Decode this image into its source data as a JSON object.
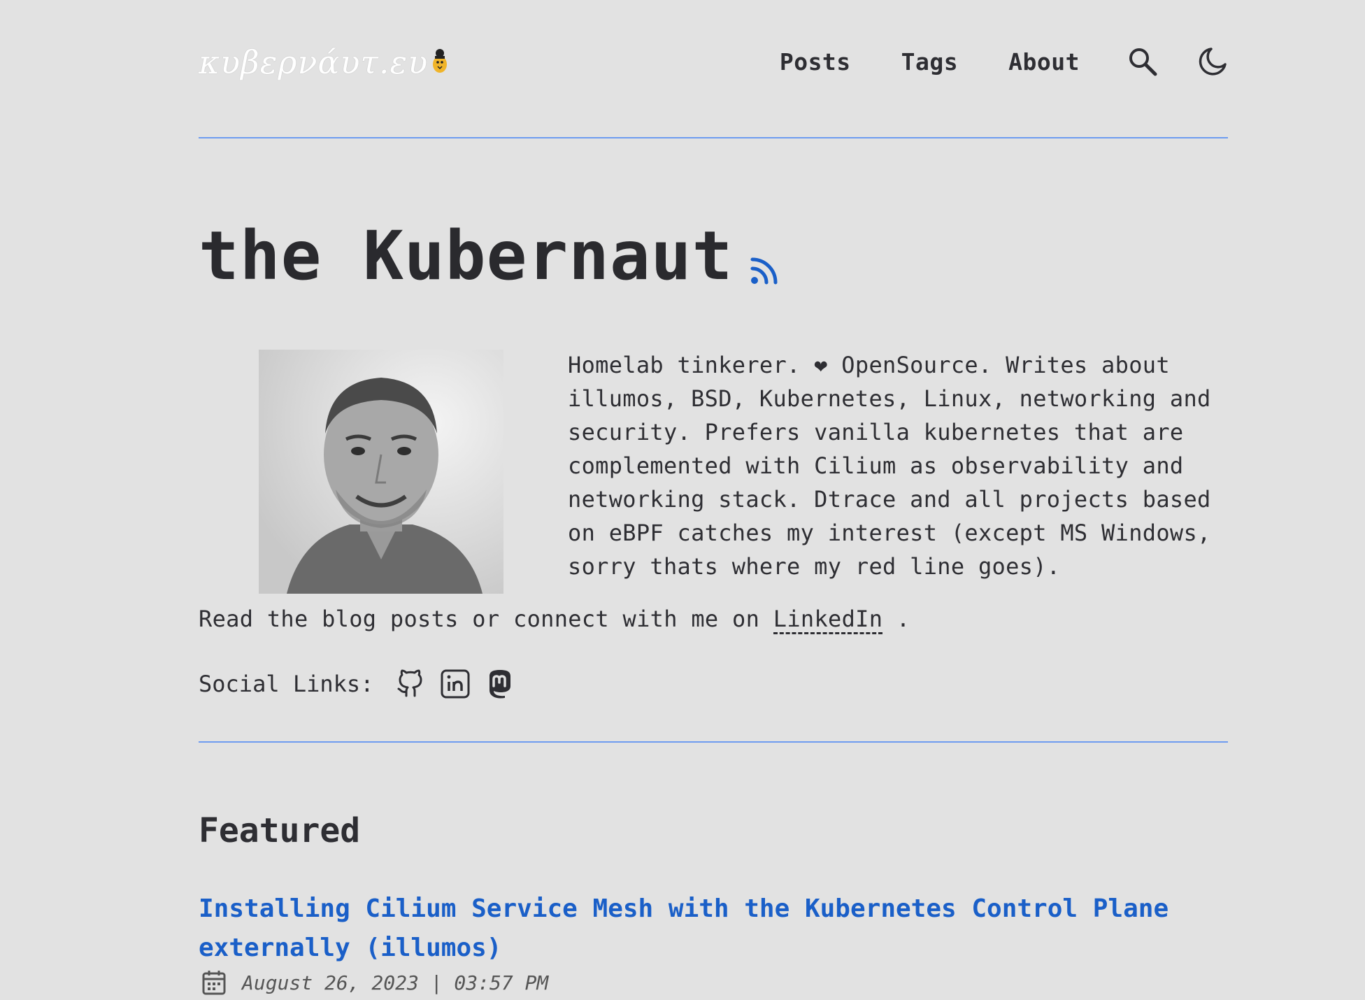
{
  "site": {
    "logo_text": "κυβερνάυτ.ευ",
    "nav": [
      {
        "label": "Posts"
      },
      {
        "label": "Tags"
      },
      {
        "label": "About"
      }
    ]
  },
  "colors": {
    "accent": "#1a5fc8",
    "divider": "#6e9cf0",
    "background": "#e2e2e2",
    "text": "#2e2e33"
  },
  "icons": [
    "search-icon",
    "moon-icon",
    "rss-icon",
    "github-icon",
    "linkedin-icon",
    "mastodon-icon",
    "calendar-icon"
  ],
  "hero": {
    "title": "the Kubernaut",
    "bio": "Homelab tinkerer. ❤ OpenSource. Writes about illumos, BSD, Kubernetes, Linux, networking and security. Prefers vanilla kubernetes that are complemented with Cilium as observability and networking stack. Dtrace and all projects based on eBPF catches my interest (except MS Windows, sorry thats where my red line goes).",
    "read_text": "Read the blog posts or connect with me on",
    "linkedin_label": "LinkedIn",
    "read_suffix": " .",
    "social_label": "Social Links:"
  },
  "featured": {
    "heading": "Featured",
    "posts": [
      {
        "title": "Installing Cilium Service Mesh with the Kubernetes Control Plane externally (illumos)",
        "date": "August 26, 2023 | 03:57 PM"
      }
    ]
  }
}
